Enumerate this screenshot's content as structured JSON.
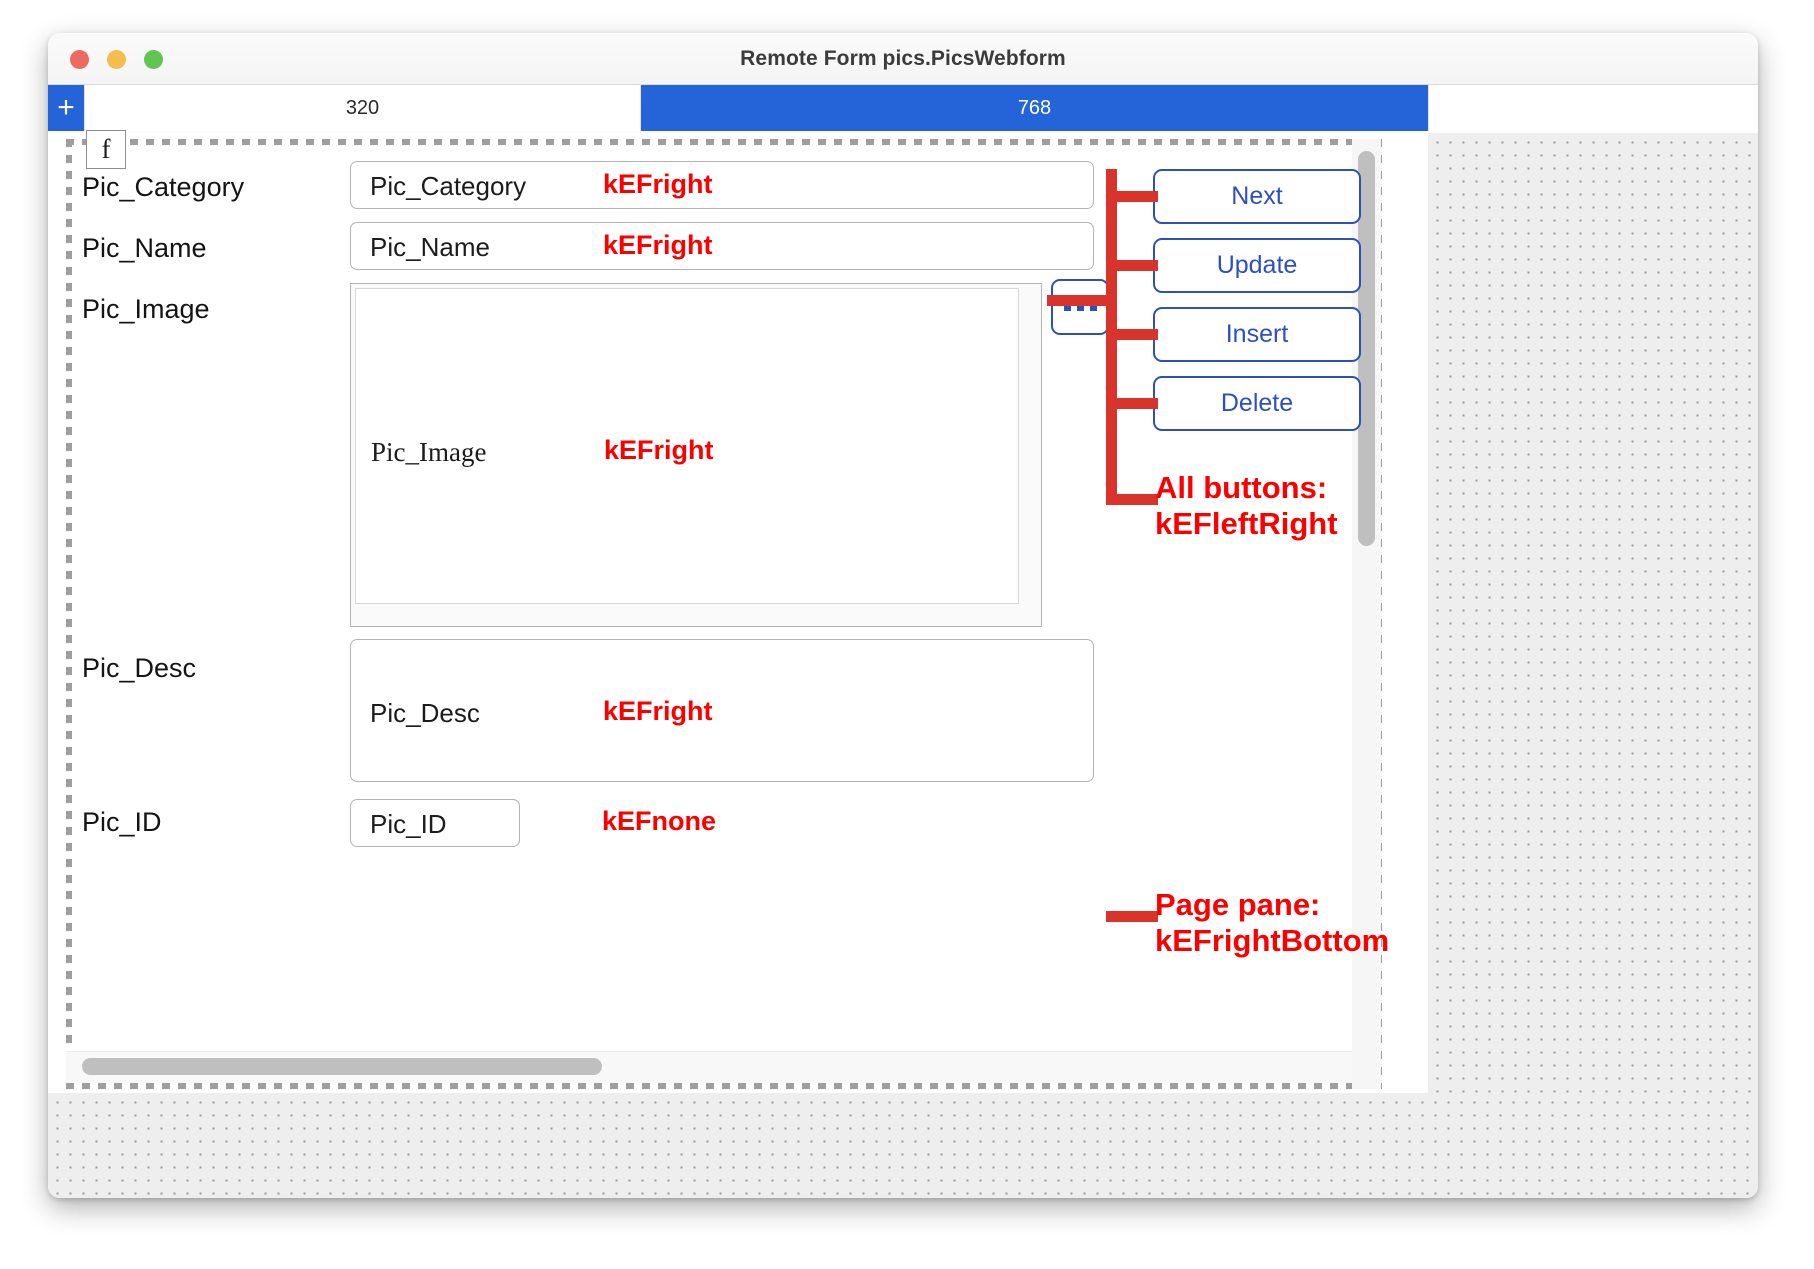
{
  "window": {
    "title": "Remote Form pics.PicsWebform",
    "traffic_lights": [
      "close",
      "minimize",
      "zoom"
    ]
  },
  "breakpoints": {
    "add_label": "+",
    "segments": [
      {
        "label": "320",
        "active": false
      },
      {
        "label": "768",
        "active": true
      }
    ]
  },
  "designer": {
    "form_handle_label": "f",
    "labels": [
      {
        "text": "Pic_Category"
      },
      {
        "text": "Pic_Name"
      },
      {
        "text": "Pic_Image"
      },
      {
        "text": "Pic_Desc"
      },
      {
        "text": "Pic_ID"
      }
    ],
    "fields": [
      {
        "placeholder": "Pic_Category",
        "ef": "kEFright"
      },
      {
        "placeholder": "Pic_Name",
        "ef": "kEFright"
      },
      {
        "placeholder": "Pic_Image",
        "ef": "kEFright"
      },
      {
        "placeholder": "Pic_Desc",
        "ef": "kEFright"
      },
      {
        "placeholder": "Pic_ID",
        "ef": "kEFnone"
      }
    ],
    "picker_button": {
      "label": "..."
    },
    "buttons": [
      {
        "label": "Next"
      },
      {
        "label": "Update"
      },
      {
        "label": "Insert"
      },
      {
        "label": "Delete"
      }
    ]
  },
  "annotations": [
    {
      "line1": "All buttons:",
      "line2": "kEFleftRight"
    },
    {
      "line1": "Page pane:",
      "line2": "kEFrightBottom"
    }
  ],
  "colors": {
    "accent_blue": "#2563d8",
    "button_blue": "#2d4fc0",
    "annotation_red": "#fc0000",
    "leader_red": "#d9342b"
  }
}
